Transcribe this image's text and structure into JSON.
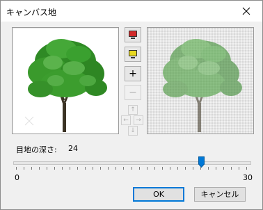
{
  "window": {
    "title": "キャンバス地",
    "close_icon": "close-icon"
  },
  "tools": {
    "fit_icon": "monitor-red-icon",
    "actual_size_icon": "monitor-yellow-icon",
    "zoom_in_label": "+",
    "zoom_out_label": "−",
    "pan_up_label": "↑",
    "pan_left_label": "←",
    "pan_right_label": "→",
    "pan_down_label": "↓"
  },
  "settings": {
    "depth_label": "目地の深さ:",
    "depth_value": "24",
    "slider_min": "0",
    "slider_max": "30",
    "slider_level": 0.8
  },
  "buttons": {
    "ok": "OK",
    "cancel": "キャンセル"
  },
  "colors": {
    "accent": "#0078d7",
    "thumb": "#0078d7"
  }
}
